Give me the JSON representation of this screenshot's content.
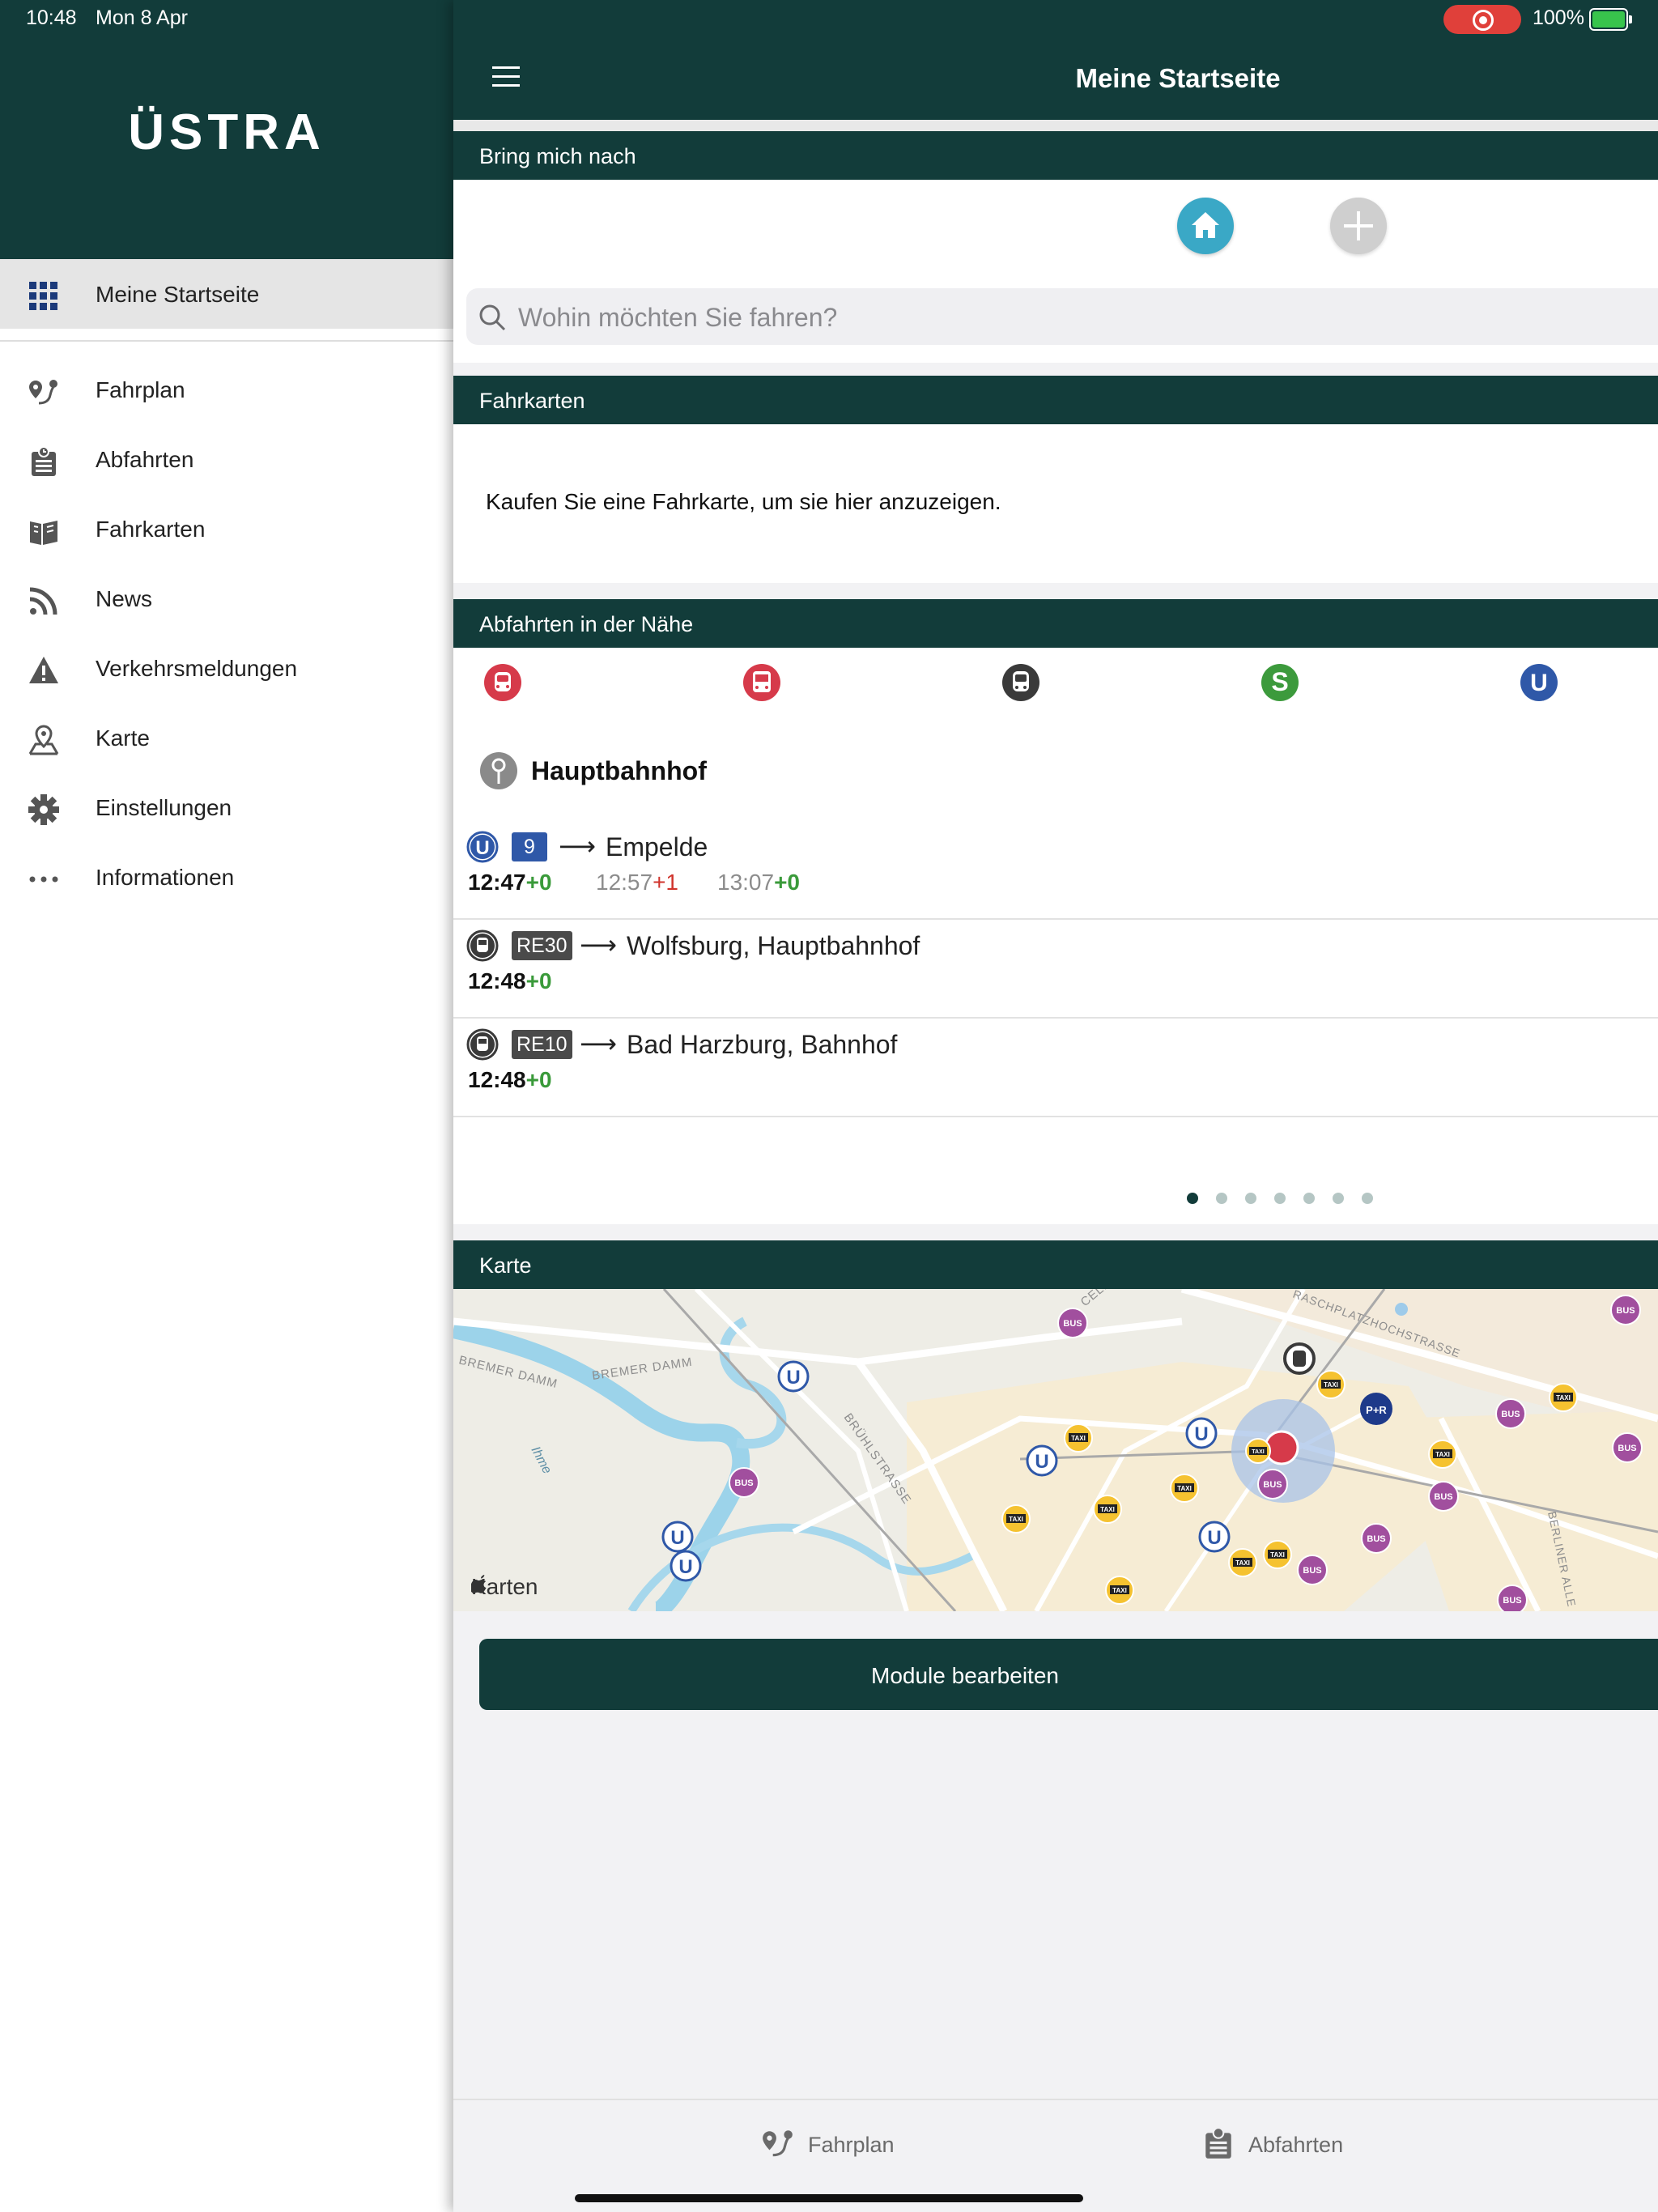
{
  "status_bar": {
    "time": "10:48",
    "date": "Mon 8 Apr",
    "battery": "100%"
  },
  "sidebar": {
    "brand": "ÜSTRA",
    "items": [
      {
        "label": "Meine Startseite",
        "icon": "grid-icon",
        "active": true
      },
      {
        "label": "Fahrplan",
        "icon": "route-pin-icon"
      },
      {
        "label": "Abfahrten",
        "icon": "departure-board-icon"
      },
      {
        "label": "Fahrkarten",
        "icon": "tickets-icon"
      },
      {
        "label": "News",
        "icon": "rss-icon"
      },
      {
        "label": "Verkehrsmeldungen",
        "icon": "warning-icon"
      },
      {
        "label": "Karte",
        "icon": "map-pin-icon"
      },
      {
        "label": "Einstellungen",
        "icon": "gear-icon"
      },
      {
        "label": "Informationen",
        "icon": "more-dots-icon"
      }
    ]
  },
  "header": {
    "title": "Meine Startseite"
  },
  "bring_me": {
    "title": "Bring mich nach",
    "search_placeholder": "Wohin möchten Sie fahren?"
  },
  "tickets": {
    "title": "Fahrkarten",
    "empty_text": "Kaufen Sie eine Fahrkarte, um sie hier anzuzeigen."
  },
  "nearby": {
    "title": "Abfahrten in der Nähe",
    "modes": [
      "tram-icon",
      "regional-train-icon",
      "train-icon",
      "s-bahn-icon",
      "u-bahn-icon"
    ],
    "station": "Hauptbahnhof",
    "departures": [
      {
        "line": "9",
        "arrow": "⟶",
        "destination": "Empelde",
        "times": [
          {
            "time": "12:47",
            "delay": "+0"
          },
          {
            "time": "12:57",
            "delay": "+1"
          },
          {
            "time": "13:07",
            "delay": "+0"
          }
        ]
      },
      {
        "line": "RE30",
        "arrow": "⟶",
        "destination": "Wolfsburg, Hauptbahnhof",
        "times": [
          {
            "time": "12:48",
            "delay": "+0"
          }
        ]
      },
      {
        "line": "RE10",
        "arrow": "⟶",
        "destination": "Bad Harzburg, Bahnhof",
        "times": [
          {
            "time": "12:48",
            "delay": "+0"
          }
        ]
      }
    ],
    "pager": {
      "pages": 7,
      "current": 1
    }
  },
  "map_section": {
    "title": "Karte",
    "credit": "Karten",
    "labels": {
      "bremer_damm_1": "BREMER DAMM",
      "bremer_damm_2": "BREMER DAMM",
      "bruehlstrasse": "BRÜHLSTRASSE",
      "ihme": "Ihme",
      "celle": "CELLE",
      "raschplatz": "RASCHPLATZHOCHSTRASSE",
      "berliner_allee": "BERLINER ALLE"
    },
    "poi": {
      "u": "U",
      "bus": "BUS",
      "taxi": "TAXI",
      "park_ride": "P+R"
    }
  },
  "actions": {
    "edit_modules": "Module bearbeiten"
  },
  "tabbar": {
    "items": [
      {
        "label": "Fahrplan"
      },
      {
        "label": "Abfahrten"
      }
    ]
  },
  "colors": {
    "brand_dark": "#123c3a",
    "accent_blue": "#3aa8c6",
    "u_bahn": "#2f58a8",
    "s_bahn": "#3c9a3c",
    "tram": "#d63a4a",
    "bus": "#a14f9e",
    "taxi": "#f5c230"
  }
}
